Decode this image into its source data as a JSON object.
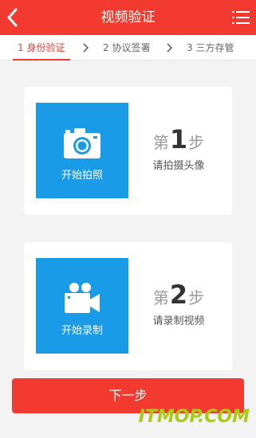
{
  "header": {
    "title": "视频验证",
    "back_icon": "chevron-left-icon",
    "menu_icon": "list-menu-icon"
  },
  "steps": [
    {
      "label": "1 身份验证",
      "active": true
    },
    {
      "label": "2 协议签署",
      "active": false
    },
    {
      "label": "3 三方存管",
      "active": false
    }
  ],
  "cards": [
    {
      "tile_label": "开始拍照",
      "icon": "camera-icon",
      "step_prefix": "第",
      "step_number": "1",
      "step_suffix": "步",
      "desc": "请拍摄头像"
    },
    {
      "tile_label": "开始录制",
      "icon": "video-camera-icon",
      "step_prefix": "第",
      "step_number": "2",
      "step_suffix": "步",
      "desc": "请录制视频"
    }
  ],
  "next_button": "下一步",
  "watermark": "ITMOP.COM",
  "colors": {
    "accent": "#f23a30",
    "tile": "#1a9be8",
    "background": "#f3f3f3"
  }
}
